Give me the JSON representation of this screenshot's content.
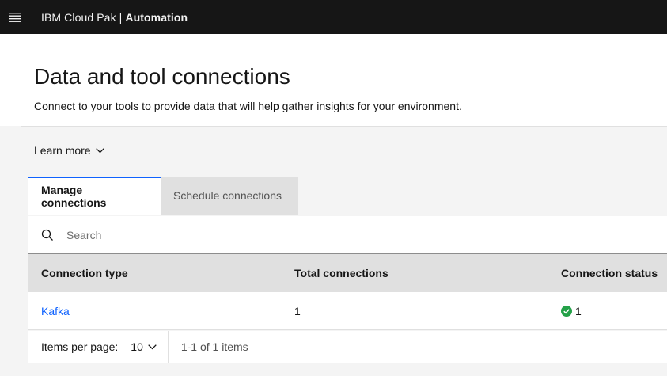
{
  "topbar": {
    "brand_light": "IBM Cloud Pak | ",
    "brand_bold": "Automation",
    "menu_icon": "hamburger-menu-icon"
  },
  "header": {
    "title": "Data and tool connections",
    "subtitle": "Connect to your tools to provide data that will help gather insights for your environment."
  },
  "learn_more": {
    "label": "Learn more",
    "icon": "chevron-down-icon"
  },
  "tabs": [
    {
      "label": "Manage connections",
      "active": true
    },
    {
      "label": "Schedule connections",
      "active": false
    }
  ],
  "search": {
    "placeholder": "Search",
    "value": "",
    "icon": "search-icon"
  },
  "table": {
    "headers": [
      "Connection type",
      "Total connections",
      "Connection status"
    ],
    "rows": [
      {
        "type": "Kafka",
        "total": "1",
        "status_count": "1",
        "status_icon": "success-checkmark-icon"
      }
    ]
  },
  "pagination": {
    "per_page_label": "Items per page:",
    "per_page_value": "10",
    "range_text": "1-1 of 1 items"
  },
  "colors": {
    "topbar": "#161616",
    "accent": "#0f62fe",
    "success": "#24a148"
  }
}
